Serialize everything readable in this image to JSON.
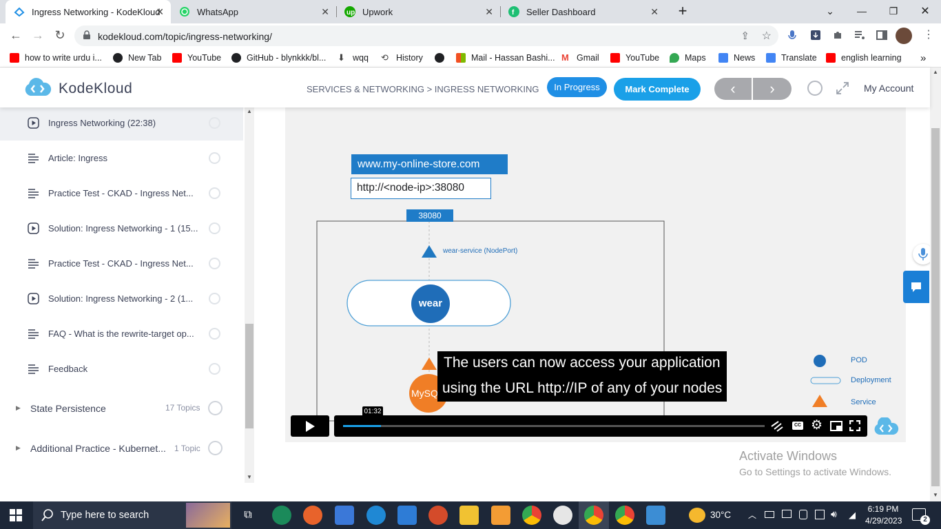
{
  "browser": {
    "tabs": [
      {
        "title": "Ingress Networking - KodeKloud",
        "icon": "kodekloud-icon",
        "active": true
      },
      {
        "title": "WhatsApp",
        "icon": "whatsapp-icon",
        "active": false
      },
      {
        "title": "Upwork",
        "icon": "upwork-icon",
        "active": false
      },
      {
        "title": "Seller Dashboard",
        "icon": "fiverr-icon",
        "active": false
      }
    ],
    "new_tab": "+",
    "url": "kodekloud.com/topic/ingress-networking/",
    "bookmarks": [
      {
        "label": "how to write urdu i...",
        "icon": "youtube-icon",
        "color": "#ff0000"
      },
      {
        "label": "New Tab",
        "icon": "globe-icon",
        "color": "#202124"
      },
      {
        "label": "YouTube",
        "icon": "youtube-icon",
        "color": "#ff0000"
      },
      {
        "label": "GitHub - blynkkk/bl...",
        "icon": "github-icon",
        "color": "#202124"
      },
      {
        "label": "wqq",
        "icon": "download-icon",
        "color": "#444"
      },
      {
        "label": "History",
        "icon": "history-icon",
        "color": "#444"
      },
      {
        "label": "",
        "icon": "globe-icon",
        "color": "#202124"
      },
      {
        "label": "Mail - Hassan Bashi...",
        "icon": "microsoft-icon",
        "color": "#f25022"
      },
      {
        "label": "Gmail",
        "icon": "gmail-icon",
        "color": "#ea4335"
      },
      {
        "label": "YouTube",
        "icon": "youtube-icon",
        "color": "#ff0000"
      },
      {
        "label": "Maps",
        "icon": "maps-icon",
        "color": "#34a853"
      },
      {
        "label": "News",
        "icon": "news-icon",
        "color": "#4285f4"
      },
      {
        "label": "Translate",
        "icon": "translate-icon",
        "color": "#4285f4"
      },
      {
        "label": "english learning",
        "icon": "youtube-icon",
        "color": "#ff0000"
      }
    ],
    "more_bookmarks": "»"
  },
  "header": {
    "logo_text": "KodeKloud",
    "breadcrumb": "SERVICES & NETWORKING > INGRESS NETWORKING",
    "status_badge": "In Progress",
    "mark_complete": "Mark Complete",
    "prev": "‹",
    "next": "›",
    "account": "My Account",
    "accent": "#1f8fe5"
  },
  "sidebar": {
    "lessons": [
      {
        "label": "Ingress Networking (22:38)",
        "icon": "video-play-icon",
        "active": true
      },
      {
        "label": "Article: Ingress",
        "icon": "article-icon",
        "active": false
      },
      {
        "label": "Practice Test - CKAD - Ingress Net...",
        "icon": "article-icon",
        "active": false
      },
      {
        "label": "Solution: Ingress Networking - 1 (15...",
        "icon": "video-play-icon",
        "active": false
      },
      {
        "label": "Practice Test - CKAD - Ingress Net...",
        "icon": "article-icon",
        "active": false
      },
      {
        "label": "Solution: Ingress Networking - 2 (1...",
        "icon": "video-play-icon",
        "active": false
      },
      {
        "label": "FAQ - What is the rewrite-target op...",
        "icon": "article-icon",
        "active": false
      },
      {
        "label": "Feedback",
        "icon": "article-icon",
        "active": false
      }
    ],
    "sections": [
      {
        "title": "State Persistence",
        "count": "17 Topics"
      },
      {
        "title": "Additional Practice - Kubernet...",
        "count": "1 Topic"
      }
    ]
  },
  "video": {
    "diagram": {
      "domain": "www.my-online-store.com",
      "url": "http://<node-ip>:38080",
      "port": "38080",
      "service_label": "wear-service (NodePort)",
      "pod_label": "wear",
      "mysql_label": "MySQL",
      "legend": [
        "POD",
        "Deployment",
        "Service"
      ]
    },
    "caption_line1": "The users can now access your application",
    "caption_line2": "using the URL http://IP of any of your nodes",
    "time_tooltip": "01:32",
    "progress": 0.09
  },
  "watermark": {
    "line1": "Activate Windows",
    "line2": "Go to Settings to activate Windows."
  },
  "taskbar": {
    "search_placeholder": "Type here to search",
    "weather": "30°C",
    "time": "6:19 PM",
    "date": "4/29/2023",
    "notifications": "2"
  }
}
